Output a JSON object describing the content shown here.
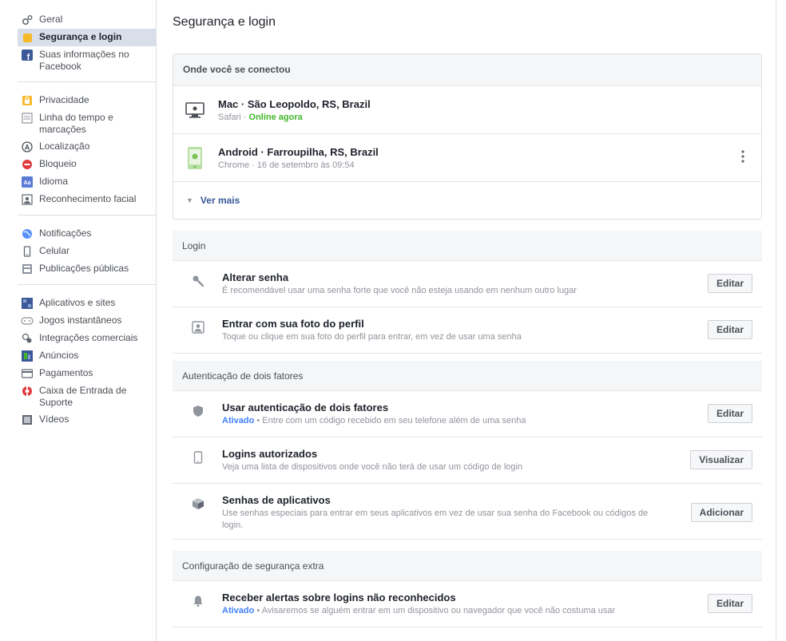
{
  "sidebar": {
    "group1": [
      {
        "label": "Geral",
        "icon": "gears-icon"
      },
      {
        "label": "Segurança e login",
        "icon": "shield-icon",
        "active": true
      },
      {
        "label": "Suas informações no Facebook",
        "icon": "facebook-icon"
      }
    ],
    "group2": [
      {
        "label": "Privacidade",
        "icon": "lock-icon"
      },
      {
        "label": "Linha do tempo e marcações",
        "icon": "timeline-icon"
      },
      {
        "label": "Localização",
        "icon": "location-icon"
      },
      {
        "label": "Bloqueio",
        "icon": "block-icon"
      },
      {
        "label": "Idioma",
        "icon": "language-icon"
      },
      {
        "label": "Reconhecimento facial",
        "icon": "face-icon"
      }
    ],
    "group3": [
      {
        "label": "Notificações",
        "icon": "globe-icon"
      },
      {
        "label": "Celular",
        "icon": "mobile-icon"
      },
      {
        "label": "Publicações públicas",
        "icon": "posts-icon"
      }
    ],
    "group4": [
      {
        "label": "Aplicativos e sites",
        "icon": "apps-icon"
      },
      {
        "label": "Jogos instantâneos",
        "icon": "games-icon"
      },
      {
        "label": "Integrações comerciais",
        "icon": "integrations-icon"
      },
      {
        "label": "Anúncios",
        "icon": "ads-icon"
      },
      {
        "label": "Pagamentos",
        "icon": "payments-icon"
      },
      {
        "label": "Caixa de Entrada de Suporte",
        "icon": "lifebuoy-icon"
      },
      {
        "label": "Vídeos",
        "icon": "video-icon"
      }
    ]
  },
  "page": {
    "title": "Segurança e login"
  },
  "where": {
    "header": "Onde você se conectou",
    "devices": [
      {
        "title": "Mac · São Leopoldo, RS, Brazil",
        "browser": "Safari · ",
        "status": "Online agora"
      },
      {
        "title": "Android · Farroupilha, RS, Brazil",
        "browser": "Chrome · 16 de setembro às 09:54",
        "status": ""
      }
    ],
    "see_more": "Ver mais"
  },
  "login": {
    "header": "Login",
    "rows": [
      {
        "title": "Alterar senha",
        "desc": "É recomendável usar uma senha forte que você não esteja usando em nenhum outro lugar",
        "button": "Editar"
      },
      {
        "title": "Entrar com sua foto do perfil",
        "desc": "Toque ou clique em sua foto do perfil para entrar, em vez de usar uma senha",
        "button": "Editar"
      }
    ]
  },
  "twofa": {
    "header": "Autenticação de dois fatores",
    "rows": [
      {
        "title": "Usar autenticação de dois fatores",
        "status": "Ativado",
        "desc": " • Entre com um código recebido em seu telefone além de uma senha",
        "button": "Editar"
      },
      {
        "title": "Logins autorizados",
        "desc": "Veja uma lista de dispositivos onde você não terá de usar um código de login",
        "button": "Visualizar"
      },
      {
        "title": "Senhas de aplicativos",
        "desc": "Use senhas especiais para entrar em seus aplicativos em vez de usar sua senha do Facebook ou códigos de login.",
        "button": "Adicionar"
      }
    ]
  },
  "extra": {
    "header": "Configuração de segurança extra",
    "rows": [
      {
        "title": "Receber alertas sobre logins não reconhecidos",
        "status": "Ativado",
        "desc": " • Avisaremos se alguém entrar em um dispositivo ou navegador que você não costuma usar",
        "button": "Editar"
      }
    ]
  },
  "colors": {
    "accent": "#385898",
    "online": "#42b72a",
    "active_bg": "#d8dfea",
    "status_on": "#4080ff"
  }
}
